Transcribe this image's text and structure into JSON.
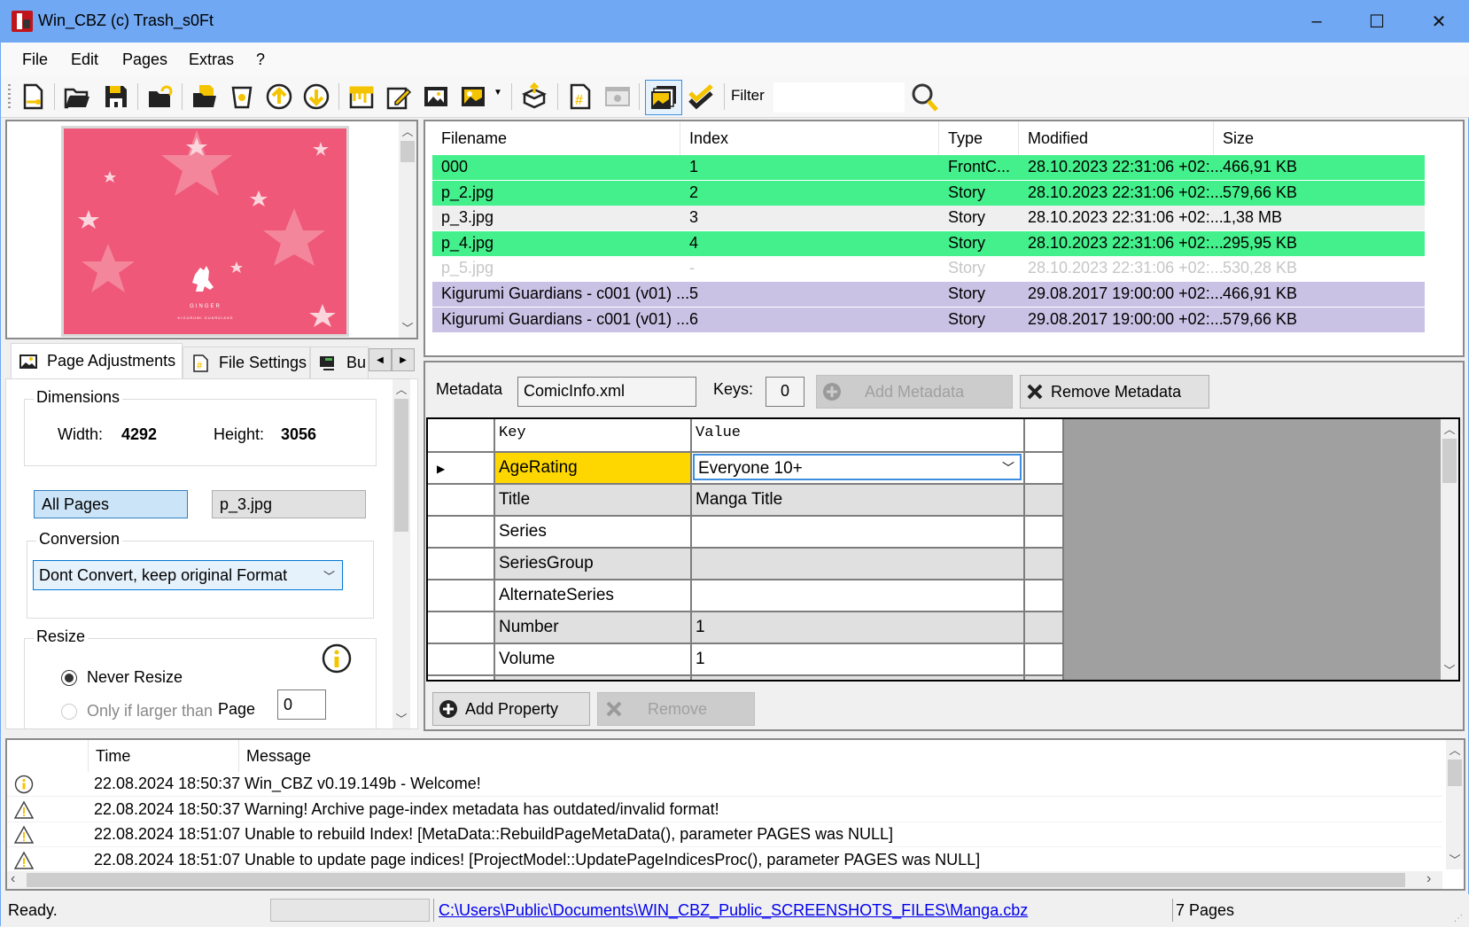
{
  "window": {
    "title": "Win_CBZ (c) Trash_s0Ft",
    "controls": {
      "minimize": "–",
      "maximize": "☐",
      "close": "✕"
    }
  },
  "menu": [
    "File",
    "Edit",
    "Pages",
    "Extras",
    "?"
  ],
  "toolbar": {
    "filter_label": "Filter",
    "filter_value": "",
    "tools": [
      "new-archive-icon",
      "open-folder-icon",
      "save-icon",
      "reopen-icon",
      "add-files-icon",
      "delete-icon",
      "move-up-icon",
      "move-down-icon",
      "split-page-icon",
      "edit-page-icon",
      "image-frame-icon",
      "image-icon",
      "extract-icon",
      "page-index-icon",
      "info-icon",
      "image-stack-icon",
      "validate-icon",
      "search-icon"
    ]
  },
  "colors": {
    "titlebar": "#70a8f3",
    "row_green": "#44f08b",
    "row_purple": "#c9c2e4",
    "key_highlight": "#ffd700",
    "icon_yellow": "#f5c400",
    "preview_pink": "#ef5878"
  },
  "preview": {
    "caption": "GINGER",
    "subcaption": "KIGURUMI GUARDIANS"
  },
  "left_tabs": [
    {
      "label": "Page Adjustments",
      "selected": true
    },
    {
      "label": "File Settings",
      "selected": false
    },
    {
      "label": "Bu",
      "selected": false
    }
  ],
  "page_adjustments": {
    "dimensions_title": "Dimensions",
    "width_label": "Width:",
    "width_value": "4292",
    "height_label": "Height:",
    "height_value": "3056",
    "all_pages_label": "All Pages",
    "current_page_label": "p_3.jpg",
    "conversion_title": "Conversion",
    "conversion_value": "Dont Convert, keep original Format",
    "resize_title": "Resize",
    "never_resize_label": "Never Resize",
    "only_if_larger_label": "Only if larger than",
    "page_label": "Page",
    "page_value": "0"
  },
  "file_list": {
    "columns": [
      "Filename",
      "Index",
      "Type",
      "Modified",
      "Size"
    ],
    "rows": [
      {
        "filename": "000",
        "index": "1",
        "type": "FrontC...",
        "modified": "28.10.2023 22:31:06 +02:...",
        "size": "466,91 KB",
        "status": "green"
      },
      {
        "filename": "p_2.jpg",
        "index": "2",
        "type": "Story",
        "modified": "28.10.2023 22:31:06 +02:...",
        "size": "579,66 KB",
        "status": "green"
      },
      {
        "filename": "p_3.jpg",
        "index": "3",
        "type": "Story",
        "modified": "28.10.2023 22:31:06 +02:...",
        "size": "1,38 MB",
        "status": "grey"
      },
      {
        "filename": "p_4.jpg",
        "index": "4",
        "type": "Story",
        "modified": "28.10.2023 22:31:06 +02:...",
        "size": "295,95 KB",
        "status": "green"
      },
      {
        "filename": "p_5.jpg",
        "index": "-",
        "type": "Story",
        "modified": "28.10.2023 22:31:06 +02:...",
        "size": "530,28 KB",
        "status": "white"
      },
      {
        "filename": "Kigurumi Guardians - c001 (v01) ...",
        "index": "5",
        "type": "Story",
        "modified": "29.08.2017 19:00:00 +02:...",
        "size": "466,91 KB",
        "status": "purple"
      },
      {
        "filename": "Kigurumi Guardians - c001 (v01) ...",
        "index": "6",
        "type": "Story",
        "modified": "29.08.2017 19:00:00 +02:...",
        "size": "579,66 KB",
        "status": "purple"
      }
    ]
  },
  "metadata": {
    "label": "Metadata",
    "file_value": "ComicInfo.xml",
    "keys_label": "Keys:",
    "keys_value": "0",
    "add_metadata_label": "Add Metadata",
    "remove_metadata_label": "Remove Metadata",
    "grid_columns": [
      "Key",
      "Value"
    ],
    "grid_rows": [
      {
        "key": "AgeRating",
        "value": "Everyone 10+",
        "current": true
      },
      {
        "key": "Title",
        "value": "Manga Title"
      },
      {
        "key": "Series",
        "value": ""
      },
      {
        "key": "SeriesGroup",
        "value": ""
      },
      {
        "key": "AlternateSeries",
        "value": ""
      },
      {
        "key": "Number",
        "value": "1"
      },
      {
        "key": "Volume",
        "value": "1"
      }
    ],
    "add_property_label": "Add Property",
    "remove_label": "Remove"
  },
  "log": {
    "columns": [
      "",
      "Time",
      "Message"
    ],
    "rows": [
      {
        "icon": "info-icon",
        "time": "22.08.2024 18:50:37",
        "message": "Win_CBZ v0.19.149b  - Welcome!"
      },
      {
        "icon": "warning-icon",
        "time": "22.08.2024 18:50:37",
        "message": "Warning! Archive page-index metadata has outdated/invalid format!"
      },
      {
        "icon": "warning-icon",
        "time": "22.08.2024 18:51:07",
        "message": "Unable to rebuild Index! [MetaData::RebuildPageMetaData(), parameter PAGES was NULL]"
      },
      {
        "icon": "warning-icon",
        "time": "22.08.2024 18:51:07",
        "message": "Unable to update page indices! [ProjectModel::UpdatePageIndicesProc(), parameter PAGES was NULL]"
      }
    ]
  },
  "statusbar": {
    "status": "Ready.",
    "path": "C:\\Users\\Public\\Documents\\WIN_CBZ_Public_SCREENSHOTS_FILES\\Manga.cbz",
    "pages": "7 Pages"
  }
}
